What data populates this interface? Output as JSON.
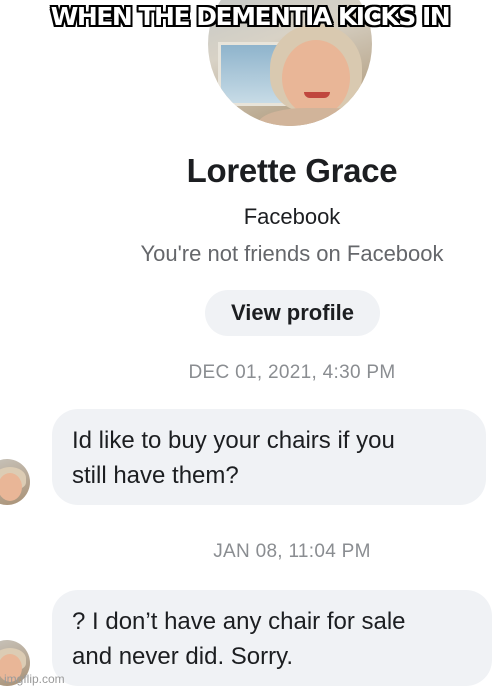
{
  "meme": {
    "caption": "WHEN THE DEMENTIA KICKS IN",
    "watermark": "imgflip.com"
  },
  "profile": {
    "name": "Lorette Grace",
    "platform": "Facebook",
    "friend_status": "You're not friends on Facebook",
    "view_profile_label": "View profile"
  },
  "conversation": {
    "messages": [
      {
        "timestamp": "DEC 01, 2021, 4:30 PM",
        "lines": [
          "Id like to buy your chairs if you",
          "still have them?"
        ]
      },
      {
        "timestamp": "JAN 08, 11:04 PM",
        "lines": [
          "? I don’t have any chair for sale",
          "and never did. Sorry."
        ]
      }
    ]
  },
  "colors": {
    "bubble_background": "#f0f2f5",
    "primary_text": "#1c1e21",
    "secondary_text": "#65676b",
    "timestamp_text": "#8a8d91"
  },
  "icons": {
    "profile_photo": "profile-photo",
    "sender_avatar": "sender-avatar"
  }
}
